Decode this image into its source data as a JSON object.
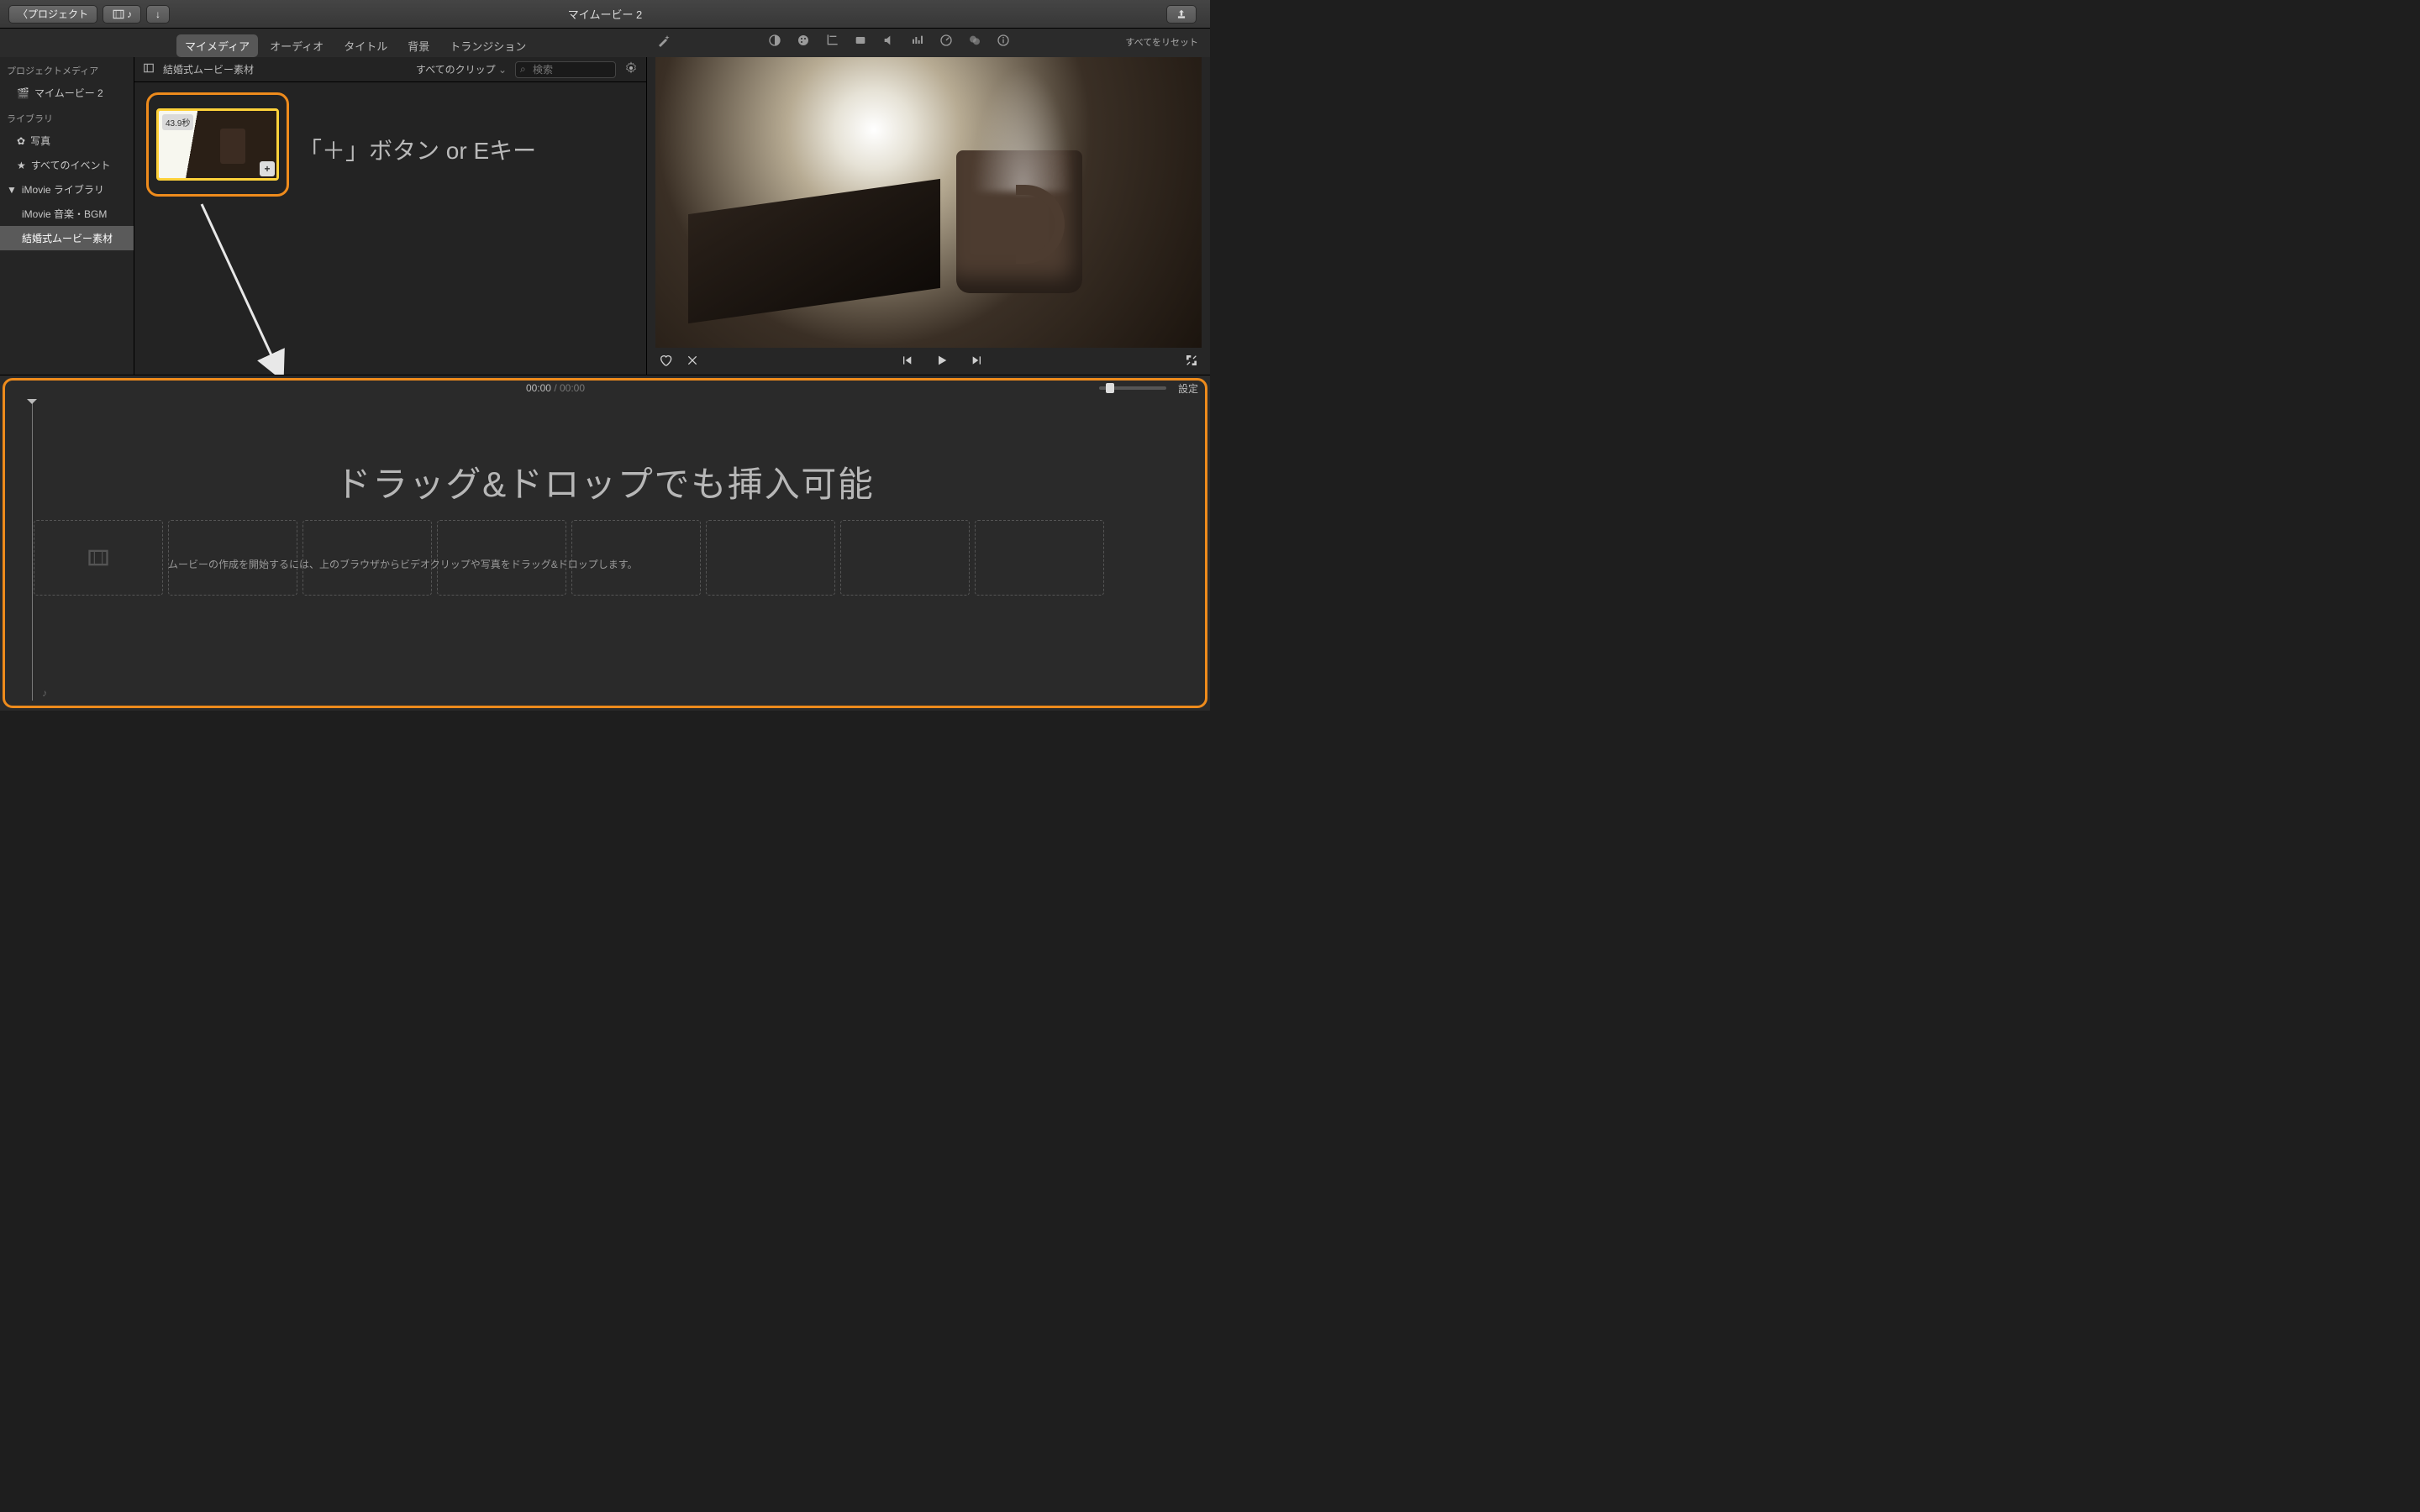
{
  "window": {
    "title": "マイムービー 2"
  },
  "toolbar": {
    "back": "プロジェクト"
  },
  "tabs": {
    "items": [
      "マイメディア",
      "オーディオ",
      "タイトル",
      "背景",
      "トランジション"
    ],
    "activeIndex": 0
  },
  "viewer_toolbar": {
    "reset": "すべてをリセット"
  },
  "sidebar": {
    "section1": "プロジェクトメディア",
    "project": "マイムービー 2",
    "section2": "ライブラリ",
    "photos": "写真",
    "allEvents": "すべてのイベント",
    "imovieLib": "iMovie ライブラリ",
    "musicBgm": "iMovie 音楽・BGM",
    "weddingEvent": "結婚式ムービー素材"
  },
  "browser": {
    "eventTitle": "結婚式ムービー素材",
    "filter": "すべてのクリップ",
    "searchPlaceholder": "検索",
    "clip": {
      "duration": "43.9秒"
    }
  },
  "annotations": {
    "plusHint": "「＋」ボタン or Eキー",
    "dragHint": "ドラッグ&ドロップでも挿入可能"
  },
  "timeline": {
    "current": "00:00",
    "total": "00:00",
    "settings": "設定",
    "emptyHint": "ムービーの作成を開始するには、上のブラウザからビデオクリップや写真をドラッグ&ドロップします。"
  }
}
